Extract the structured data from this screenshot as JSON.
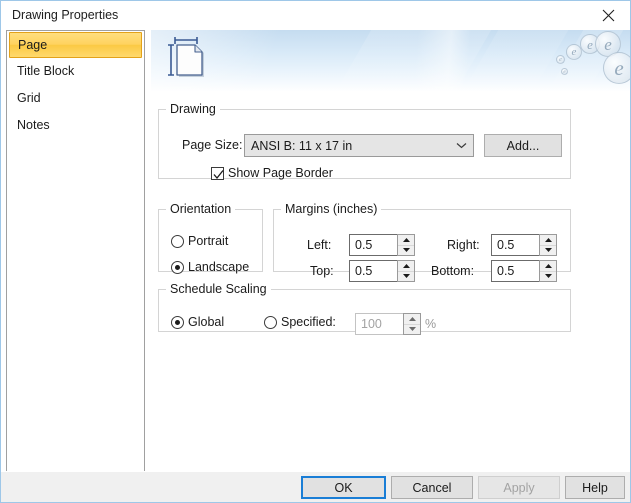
{
  "window": {
    "title": "Drawing Properties",
    "close_icon": "close-x-icon",
    "border_color": "#9ec7e8"
  },
  "sidebar": {
    "items": [
      {
        "label": "Page",
        "selected": true
      },
      {
        "label": "Title Block",
        "selected": false
      },
      {
        "label": "Grid",
        "selected": false
      },
      {
        "label": "Notes",
        "selected": false
      }
    ],
    "selected_bg": "#ffd25e",
    "selected_border": "#e3a21a"
  },
  "banner": {
    "icon_name": "page-dimension-icon",
    "decoration": "e-bubbles",
    "bubbles": [
      "e",
      "e",
      "e",
      "e"
    ],
    "gradient_top": "#c5dcf0",
    "gradient_bottom": "#ffffff"
  },
  "drawing_group": {
    "legend": "Drawing",
    "page_size_label": "Page Size:",
    "page_size_value": "ANSI B: 11 x 17 in",
    "page_size_arrow_icon": "chevron-down-icon",
    "add_button": "Add...",
    "show_page_border_label": "Show Page Border",
    "show_page_border_checked": true
  },
  "orientation_group": {
    "legend": "Orientation",
    "options": [
      {
        "label": "Portrait",
        "selected": false
      },
      {
        "label": "Landscape",
        "selected": true
      }
    ]
  },
  "margins_group": {
    "legend": "Margins (inches)",
    "fields": [
      {
        "label": "Left:",
        "value": "0.5"
      },
      {
        "label": "Right:",
        "value": "0.5"
      },
      {
        "label": "Top:",
        "value": "0.5"
      },
      {
        "label": "Bottom:",
        "value": "0.5"
      }
    ]
  },
  "schedule_group": {
    "legend": "Schedule Scaling",
    "global_label": "Global",
    "global_selected": true,
    "specified_label": "Specified:",
    "specified_selected": false,
    "specified_value": "100",
    "percent_symbol": "%",
    "specified_enabled": false
  },
  "footer": {
    "ok": "OK",
    "cancel": "Cancel",
    "apply": "Apply",
    "help": "Help",
    "apply_enabled": false,
    "default_button": "OK",
    "focus_color": "#1a7ed6"
  }
}
